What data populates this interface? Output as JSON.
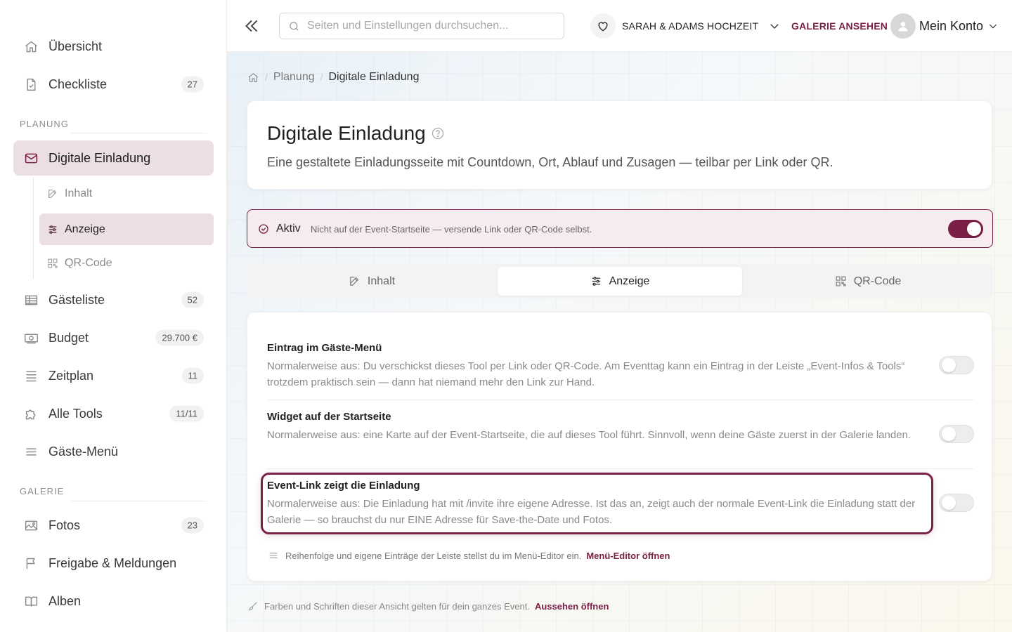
{
  "sidebar": {
    "overview": {
      "label": "Übersicht",
      "icon": "home-icon"
    },
    "checklist": {
      "label": "Checkliste",
      "badge": "27",
      "icon": "file-check-icon"
    },
    "planning_section": "PLANUNG",
    "invitation": {
      "label": "Digitale Einladung",
      "icon": "mail-icon"
    },
    "sub_items": [
      {
        "label": "Inhalt",
        "icon": "edit-icon"
      },
      {
        "label": "Anzeige",
        "icon": "sliders-icon"
      },
      {
        "label": "QR-Code",
        "icon": "qr-code-icon"
      }
    ],
    "guestlist": {
      "label": "Gästeliste",
      "badge": "52",
      "icon": "table-icon"
    },
    "budget": {
      "label": "Budget",
      "badge": "29.700 €",
      "icon": "money-icon"
    },
    "schedule": {
      "label": "Zeitplan",
      "badge": "11",
      "icon": "list-icon"
    },
    "tools": {
      "label": "Alle Tools",
      "badge": "11/11",
      "icon": "puzzle-icon"
    },
    "guest_menu": {
      "label": "Gäste-Menü",
      "icon": "menu-icon"
    },
    "gallery_section": "GALERIE",
    "photos": {
      "label": "Fotos",
      "badge": "23",
      "icon": "image-icon"
    },
    "sharing": {
      "label": "Freigabe & Meldungen",
      "icon": "flag-icon"
    },
    "albums": {
      "label": "Alben",
      "icon": "book-icon"
    }
  },
  "topbar": {
    "search_placeholder": "Seiten und Einstellungen durchsuchen...",
    "event_name": "SARAH & ADAMS HOCHZEIT",
    "gallery_link": "GALERIE ANSEHEN",
    "account_label": "Mein Konto"
  },
  "breadcrumb": {
    "parent": "Planung",
    "current": "Digitale Einladung"
  },
  "header": {
    "title": "Digitale Einladung",
    "description": "Eine gestaltete Einladungsseite mit Countdown, Ort, Ablauf und Zusagen — teilbar per Link oder QR."
  },
  "status": {
    "title": "Aktiv",
    "text": "Nicht auf der Event-Startseite — versende Link oder QR-Code selbst.",
    "enabled": true
  },
  "tabs": [
    {
      "label": "Inhalt",
      "icon": "edit-icon"
    },
    {
      "label": "Anzeige",
      "icon": "sliders-icon",
      "active": true
    },
    {
      "label": "QR-Code",
      "icon": "qr-code-icon"
    }
  ],
  "settings": [
    {
      "title": "Eintrag im Gäste-Menü",
      "description": "Normalerweise aus: Du verschickst dieses Tool per Link oder QR-Code. Am Eventtag kann ein Eintrag in der Leiste „Event-Infos & Tools“ trotzdem praktisch sein — dann hat niemand mehr den Link zur Hand.",
      "enabled": false
    },
    {
      "title": "Widget auf der Startseite",
      "description": "Normalerweise aus: eine Karte auf der Event-Startseite, die auf dieses Tool führt. Sinnvoll, wenn deine Gäste zuerst in der Galerie landen.",
      "enabled": false
    },
    {
      "title": "Event-Link zeigt die Einladung",
      "description": "Normalerweise aus: Die Einladung hat mit /invite ihre eigene Adresse. Ist das an, zeigt auch der normale Event-Link die Einladung statt der Galerie — so brauchst du nur EINE Adresse für Save-the-Date und Fotos.",
      "enabled": false
    }
  ],
  "menu_note": {
    "text": "Reihenfolge und eigene Einträge der Leiste stellst du im Menü-Editor ein.",
    "link": "Menü-Editor öffnen"
  },
  "footer_note": {
    "text": "Farben und Schriften dieser Ansicht gelten für dein ganzes Event.",
    "link": "Aussehen öffnen"
  },
  "colors": {
    "accent": "#7a1f45",
    "active_bg": "#ecdfe3"
  }
}
